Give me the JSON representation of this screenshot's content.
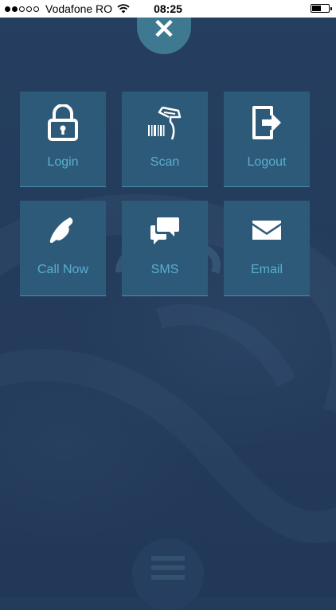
{
  "status_bar": {
    "carrier": "Vodafone RO",
    "time": "08:25",
    "signal_dots": [
      true,
      true,
      false,
      false,
      false
    ],
    "battery_level": 0.55
  },
  "close_button": {
    "icon": "close-icon"
  },
  "tiles": [
    {
      "label": "Login",
      "icon": "lock-icon"
    },
    {
      "label": "Scan",
      "icon": "barcode-scanner-icon"
    },
    {
      "label": "Logout",
      "icon": "logout-icon"
    },
    {
      "label": "Call Now",
      "icon": "phone-icon"
    },
    {
      "label": "SMS",
      "icon": "chat-bubbles-icon"
    },
    {
      "label": "Email",
      "icon": "envelope-icon"
    }
  ],
  "menu_button": {
    "icon": "hamburger-icon"
  },
  "colors": {
    "background": "#243c5c",
    "tile": "#2d5a78",
    "tile_label": "#5aaed0",
    "close_button": "#3f7891",
    "status_bar": "#ffffff"
  }
}
